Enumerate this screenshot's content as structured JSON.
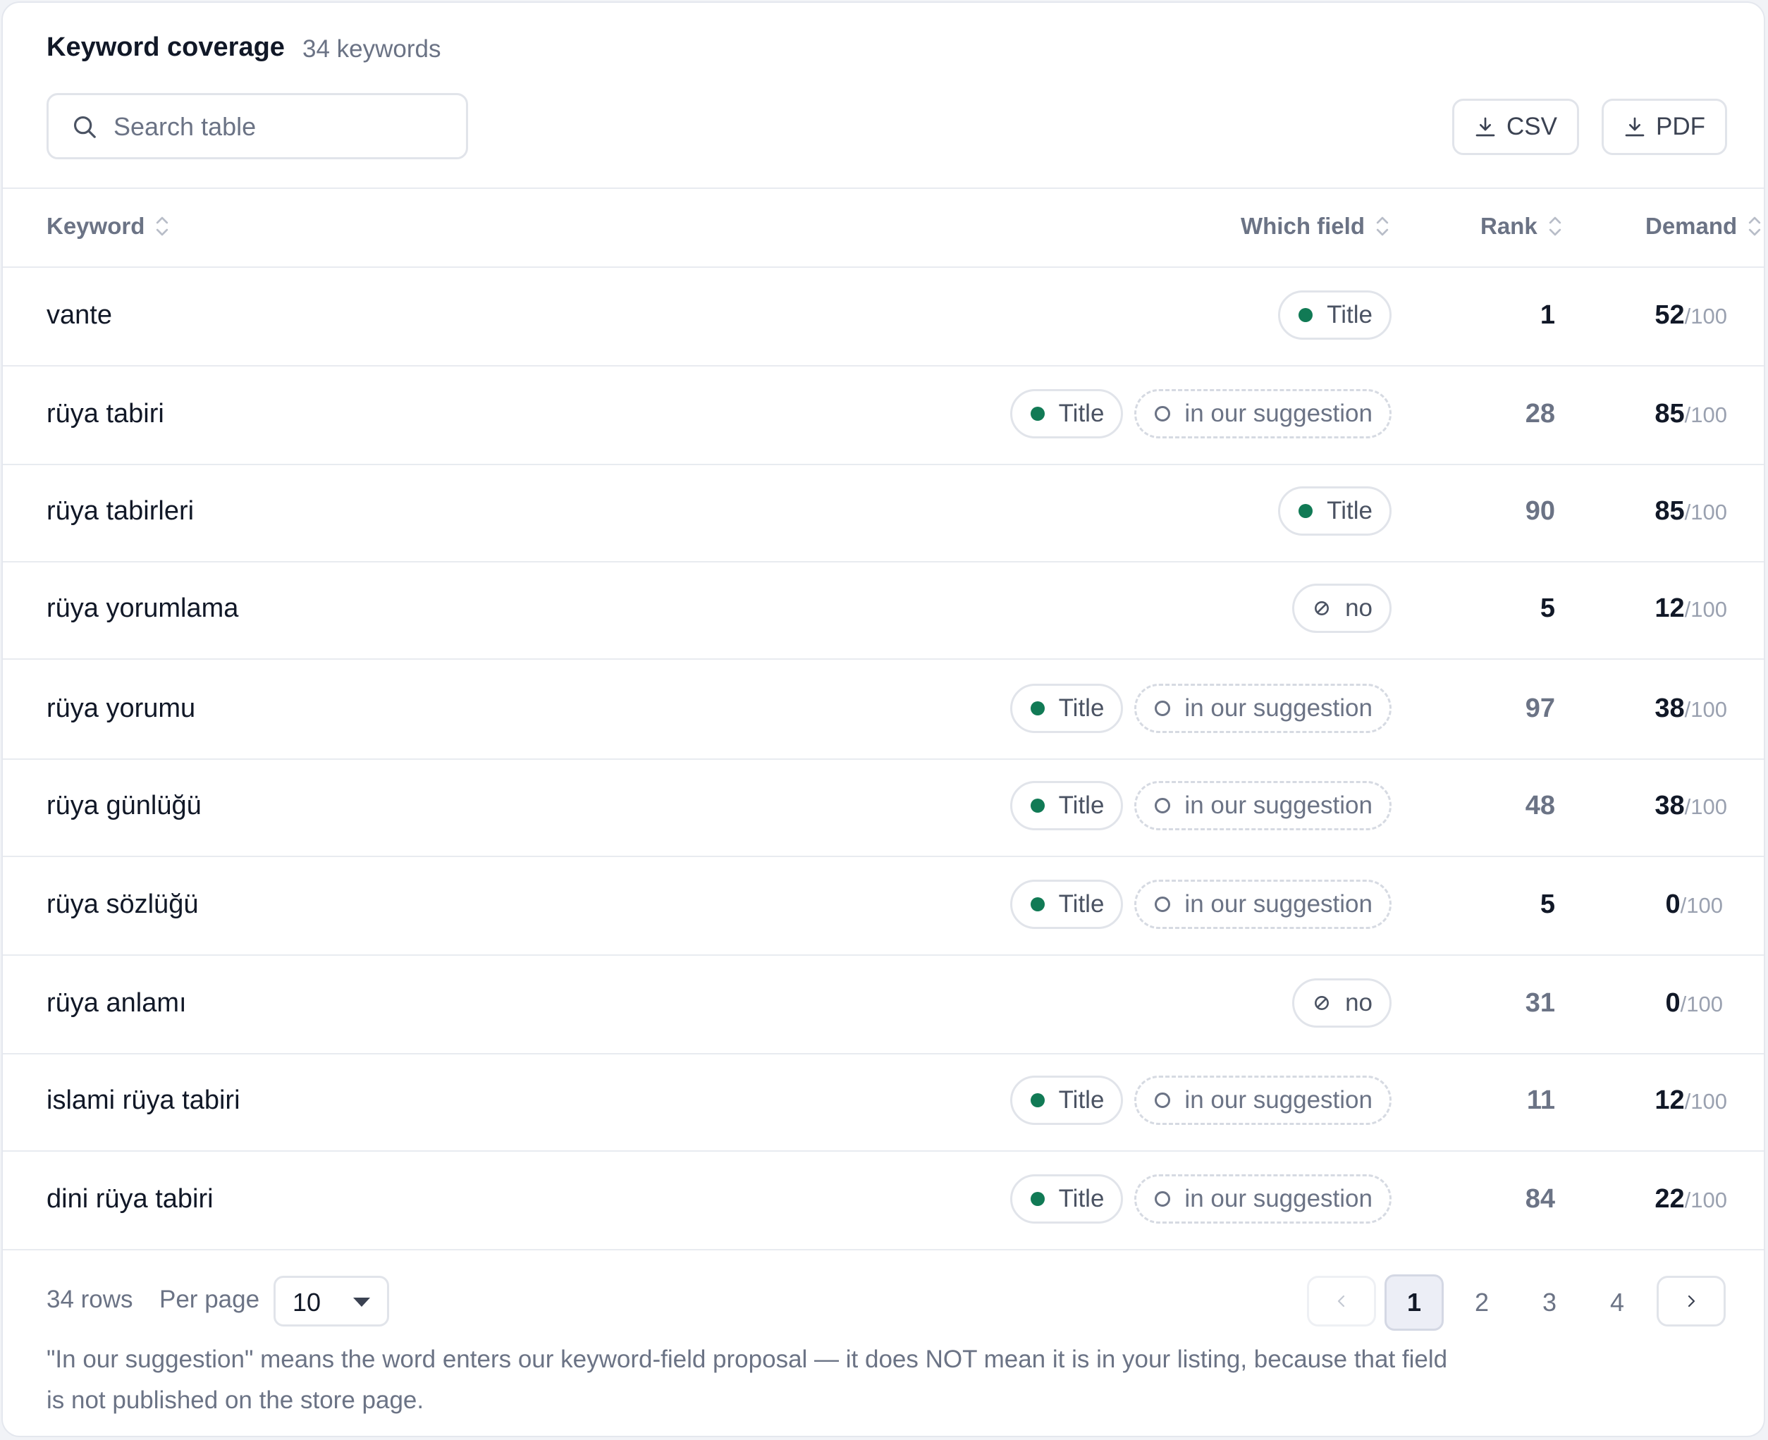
{
  "header": {
    "title": "Keyword coverage",
    "count_text": "34 keywords"
  },
  "search": {
    "placeholder": "Search table"
  },
  "export": {
    "csv_label": "CSV",
    "pdf_label": "PDF"
  },
  "columns": {
    "keyword": "Keyword",
    "field": "Which field",
    "rank": "Rank",
    "demand": "Demand"
  },
  "labels": {
    "title_tag": "Title",
    "suggestion_tag": "in our suggestion",
    "no_tag": "no",
    "demand_suffix": "/100"
  },
  "rows": [
    {
      "keyword": "vante",
      "field": "title",
      "rank": "1",
      "demand": "52"
    },
    {
      "keyword": "rüya tabiri",
      "field": "title+suggestion",
      "rank": "28",
      "demand": "85"
    },
    {
      "keyword": "rüya tabirleri",
      "field": "title",
      "rank": "90",
      "demand": "85"
    },
    {
      "keyword": "rüya yorumlama",
      "field": "no",
      "rank": "5",
      "demand": "12"
    },
    {
      "keyword": "rüya yorumu",
      "field": "title+suggestion",
      "rank": "97",
      "demand": "38"
    },
    {
      "keyword": "rüya günlüğü",
      "field": "title+suggestion",
      "rank": "48",
      "demand": "38"
    },
    {
      "keyword": "rüya sözlüğü",
      "field": "title+suggestion",
      "rank": "5",
      "demand": "0"
    },
    {
      "keyword": "rüya anlamı",
      "field": "no",
      "rank": "31",
      "demand": "0"
    },
    {
      "keyword": "islami rüya tabiri",
      "field": "title+suggestion",
      "rank": "11",
      "demand": "12"
    },
    {
      "keyword": "dini rüya tabiri",
      "field": "title+suggestion",
      "rank": "84",
      "demand": "22"
    }
  ],
  "footer": {
    "rows_text": "34 rows",
    "per_page_label": "Per page",
    "per_page_value": "10",
    "pages": [
      "1",
      "2",
      "3",
      "4"
    ],
    "current_page": "1",
    "note": "\"In our suggestion\" means the word enters our keyword-field proposal — it does NOT mean it is in your listing, because that field is not published on the store page."
  },
  "colors": {
    "accent_green": "#117a55",
    "text_dark": "#111827",
    "text_muted": "#6b7385",
    "border": "#e1e4ea"
  }
}
